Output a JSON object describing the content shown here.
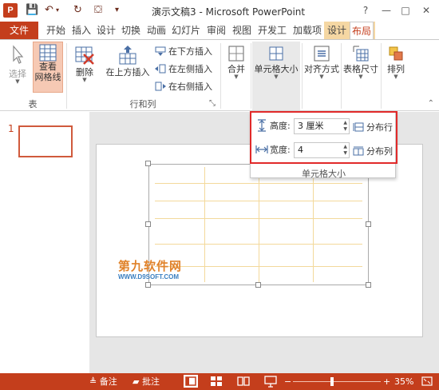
{
  "window": {
    "title": "演示文稿3 - Microsoft PowerPoint",
    "app_logo": "P",
    "controls": [
      "?",
      "—",
      "□",
      "✕"
    ]
  },
  "tabs": {
    "file": "文件",
    "items": [
      "开始",
      "插入",
      "设计",
      "切换",
      "动画",
      "幻灯片",
      "审阅",
      "视图",
      "开发工",
      "加载项",
      "设计",
      "布局"
    ],
    "active": "布局"
  },
  "ribbon": {
    "select": "选择",
    "view_gridlines": [
      "查看",
      "网格线"
    ],
    "table_group": "表",
    "delete": "删除",
    "insert_above": "在上方插入",
    "insert_below": "在下方插入",
    "insert_left": "在左侧插入",
    "insert_right": "在右侧插入",
    "rows_cols_group": "行和列",
    "merge": "合并",
    "cell_size": "单元格大小",
    "alignment": "对齐方式",
    "table_size": "表格尺寸",
    "arrange": "排列"
  },
  "cell_size_panel": {
    "height_label": "高度:",
    "height_value": "3 厘米",
    "width_label": "宽度:",
    "width_value": "4",
    "distribute_rows": "分布行",
    "distribute_cols": "分布列",
    "group_label": "单元格大小"
  },
  "thumbnails": {
    "slide_number": "1"
  },
  "watermark": {
    "brand": "第九软件网",
    "url": "WWW.D9SOFT.COM"
  },
  "statusbar": {
    "notes": "备注",
    "comments": "批注",
    "zoom": "35%",
    "zoom_fraction": 0.35
  },
  "colors": {
    "accent": "#c43e1c",
    "highlight_box": "#e12a2a",
    "table_grid": "#f3d99b"
  }
}
